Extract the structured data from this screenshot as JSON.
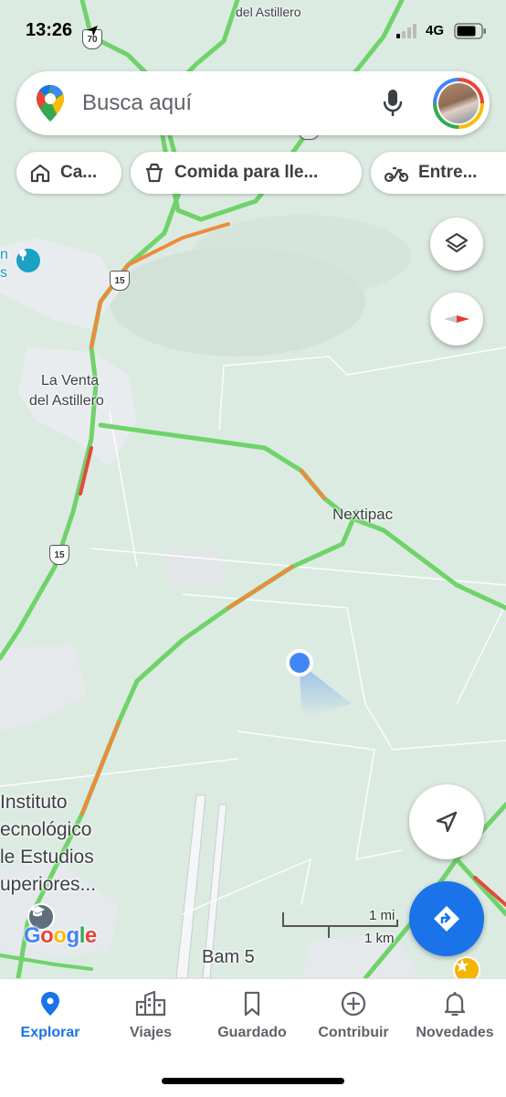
{
  "status_bar": {
    "time": "13:26",
    "network": "4G"
  },
  "search": {
    "placeholder": "Busca aquí"
  },
  "chips": [
    {
      "label": "Ca...",
      "icon": "home-icon"
    },
    {
      "label": "Comida para lle...",
      "icon": "takeout-icon"
    },
    {
      "label": "Entre...",
      "icon": "scooter-icon"
    }
  ],
  "map": {
    "labels": {
      "top_town": "del Astillero",
      "la_venta_line1": "La Venta",
      "la_venta_line2": "del Astillero",
      "nextipac": "Nextipac",
      "instituto_1": "Instituto",
      "instituto_2": "ecnológico",
      "instituto_3": "le Estudios",
      "instituto_4": "uperiores...",
      "bam": "Bam 5",
      "edge_n": "n",
      "edge_s": "s"
    },
    "highway_shields": [
      "70",
      "15",
      "15",
      "15"
    ],
    "scale": {
      "miles": "1 mi",
      "km": "1 km"
    },
    "attribution": "Google"
  },
  "bottom_nav": {
    "items": [
      {
        "label": "Explorar",
        "icon": "pin-icon",
        "active": true
      },
      {
        "label": "Viajes",
        "icon": "city-icon",
        "active": false
      },
      {
        "label": "Guardado",
        "icon": "bookmark-icon",
        "active": false
      },
      {
        "label": "Contribuir",
        "icon": "add-circle-icon",
        "active": false
      },
      {
        "label": "Novedades",
        "icon": "bell-icon",
        "active": false
      }
    ]
  },
  "colors": {
    "accent": "#1a73e8",
    "road_green": "#6fd36a",
    "road_orange": "#f08a3b",
    "map_bg": "#dcebe2"
  }
}
